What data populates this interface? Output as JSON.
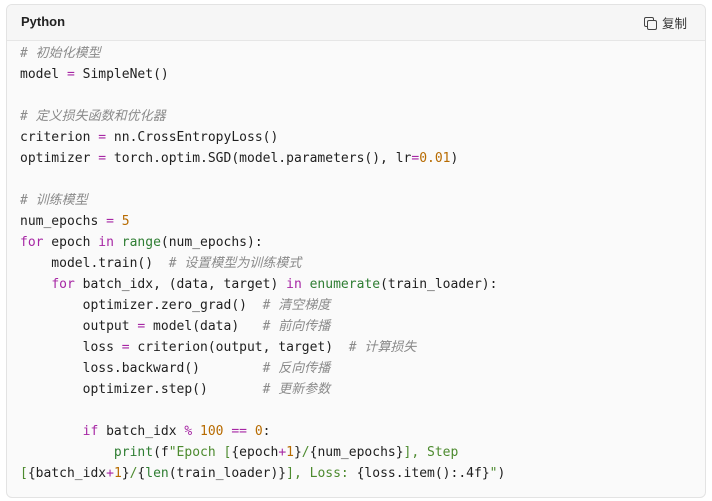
{
  "header": {
    "language": "Python",
    "copy_label": "复制",
    "copy_icon": "copy-icon"
  },
  "colors": {
    "comment": "#8a8a8a",
    "keyword": "#a626a4",
    "builtin": "#2e7d32",
    "number": "#b76b01",
    "string": "#4c8a2e"
  },
  "code": {
    "lines": [
      [
        {
          "t": "comment",
          "v": "# 初始化模型"
        }
      ],
      [
        {
          "t": "plain",
          "v": "model "
        },
        {
          "t": "op",
          "v": "="
        },
        {
          "t": "plain",
          "v": " SimpleNet()"
        }
      ],
      [],
      [
        {
          "t": "comment",
          "v": "# 定义损失函数和优化器"
        }
      ],
      [
        {
          "t": "plain",
          "v": "criterion "
        },
        {
          "t": "op",
          "v": "="
        },
        {
          "t": "plain",
          "v": " nn.CrossEntropyLoss()"
        }
      ],
      [
        {
          "t": "plain",
          "v": "optimizer "
        },
        {
          "t": "op",
          "v": "="
        },
        {
          "t": "plain",
          "v": " torch.optim.SGD(model.parameters(), lr"
        },
        {
          "t": "op",
          "v": "="
        },
        {
          "t": "number",
          "v": "0.01"
        },
        {
          "t": "plain",
          "v": ")"
        }
      ],
      [],
      [
        {
          "t": "comment",
          "v": "# 训练模型"
        }
      ],
      [
        {
          "t": "plain",
          "v": "num_epochs "
        },
        {
          "t": "op",
          "v": "="
        },
        {
          "t": "plain",
          "v": " "
        },
        {
          "t": "number",
          "v": "5"
        }
      ],
      [
        {
          "t": "keyword",
          "v": "for"
        },
        {
          "t": "plain",
          "v": " epoch "
        },
        {
          "t": "keyword",
          "v": "in"
        },
        {
          "t": "plain",
          "v": " "
        },
        {
          "t": "builtin",
          "v": "range"
        },
        {
          "t": "plain",
          "v": "(num_epochs):"
        }
      ],
      [
        {
          "t": "plain",
          "v": "    model.train()  "
        },
        {
          "t": "comment",
          "v": "# 设置模型为训练模式"
        }
      ],
      [
        {
          "t": "plain",
          "v": "    "
        },
        {
          "t": "keyword",
          "v": "for"
        },
        {
          "t": "plain",
          "v": " batch_idx, (data, target) "
        },
        {
          "t": "keyword",
          "v": "in"
        },
        {
          "t": "plain",
          "v": " "
        },
        {
          "t": "builtin",
          "v": "enumerate"
        },
        {
          "t": "plain",
          "v": "(train_loader):"
        }
      ],
      [
        {
          "t": "plain",
          "v": "        optimizer.zero_grad()  "
        },
        {
          "t": "comment",
          "v": "# 清空梯度"
        }
      ],
      [
        {
          "t": "plain",
          "v": "        output "
        },
        {
          "t": "op",
          "v": "="
        },
        {
          "t": "plain",
          "v": " model(data)   "
        },
        {
          "t": "comment",
          "v": "# 前向传播"
        }
      ],
      [
        {
          "t": "plain",
          "v": "        loss "
        },
        {
          "t": "op",
          "v": "="
        },
        {
          "t": "plain",
          "v": " criterion(output, target)  "
        },
        {
          "t": "comment",
          "v": "# 计算损失"
        }
      ],
      [
        {
          "t": "plain",
          "v": "        loss.backward()        "
        },
        {
          "t": "comment",
          "v": "# 反向传播"
        }
      ],
      [
        {
          "t": "plain",
          "v": "        optimizer.step()       "
        },
        {
          "t": "comment",
          "v": "# 更新参数"
        }
      ],
      [],
      [
        {
          "t": "plain",
          "v": "        "
        },
        {
          "t": "keyword",
          "v": "if"
        },
        {
          "t": "plain",
          "v": " batch_idx "
        },
        {
          "t": "op",
          "v": "%"
        },
        {
          "t": "plain",
          "v": " "
        },
        {
          "t": "number",
          "v": "100"
        },
        {
          "t": "plain",
          "v": " "
        },
        {
          "t": "op",
          "v": "=="
        },
        {
          "t": "plain",
          "v": " "
        },
        {
          "t": "number",
          "v": "0"
        },
        {
          "t": "plain",
          "v": ":"
        }
      ],
      [
        {
          "t": "plain",
          "v": "            "
        },
        {
          "t": "builtin",
          "v": "print"
        },
        {
          "t": "plain",
          "v": "(f"
        },
        {
          "t": "string",
          "v": "\"Epoch ["
        },
        {
          "t": "plain",
          "v": "{epoch"
        },
        {
          "t": "op",
          "v": "+"
        },
        {
          "t": "number",
          "v": "1"
        },
        {
          "t": "plain",
          "v": "}"
        },
        {
          "t": "string",
          "v": "/"
        },
        {
          "t": "plain",
          "v": "{num_epochs}"
        },
        {
          "t": "string",
          "v": "], Step"
        }
      ],
      [
        {
          "t": "string",
          "v": "["
        },
        {
          "t": "plain",
          "v": "{batch_idx"
        },
        {
          "t": "op",
          "v": "+"
        },
        {
          "t": "number",
          "v": "1"
        },
        {
          "t": "plain",
          "v": "}"
        },
        {
          "t": "string",
          "v": "/"
        },
        {
          "t": "plain",
          "v": "{"
        },
        {
          "t": "builtin",
          "v": "len"
        },
        {
          "t": "plain",
          "v": "(train_loader)}"
        },
        {
          "t": "string",
          "v": "], Loss: "
        },
        {
          "t": "plain",
          "v": "{loss.item():.4f}"
        },
        {
          "t": "string",
          "v": "\""
        },
        {
          "t": "plain",
          "v": ")"
        }
      ]
    ]
  }
}
